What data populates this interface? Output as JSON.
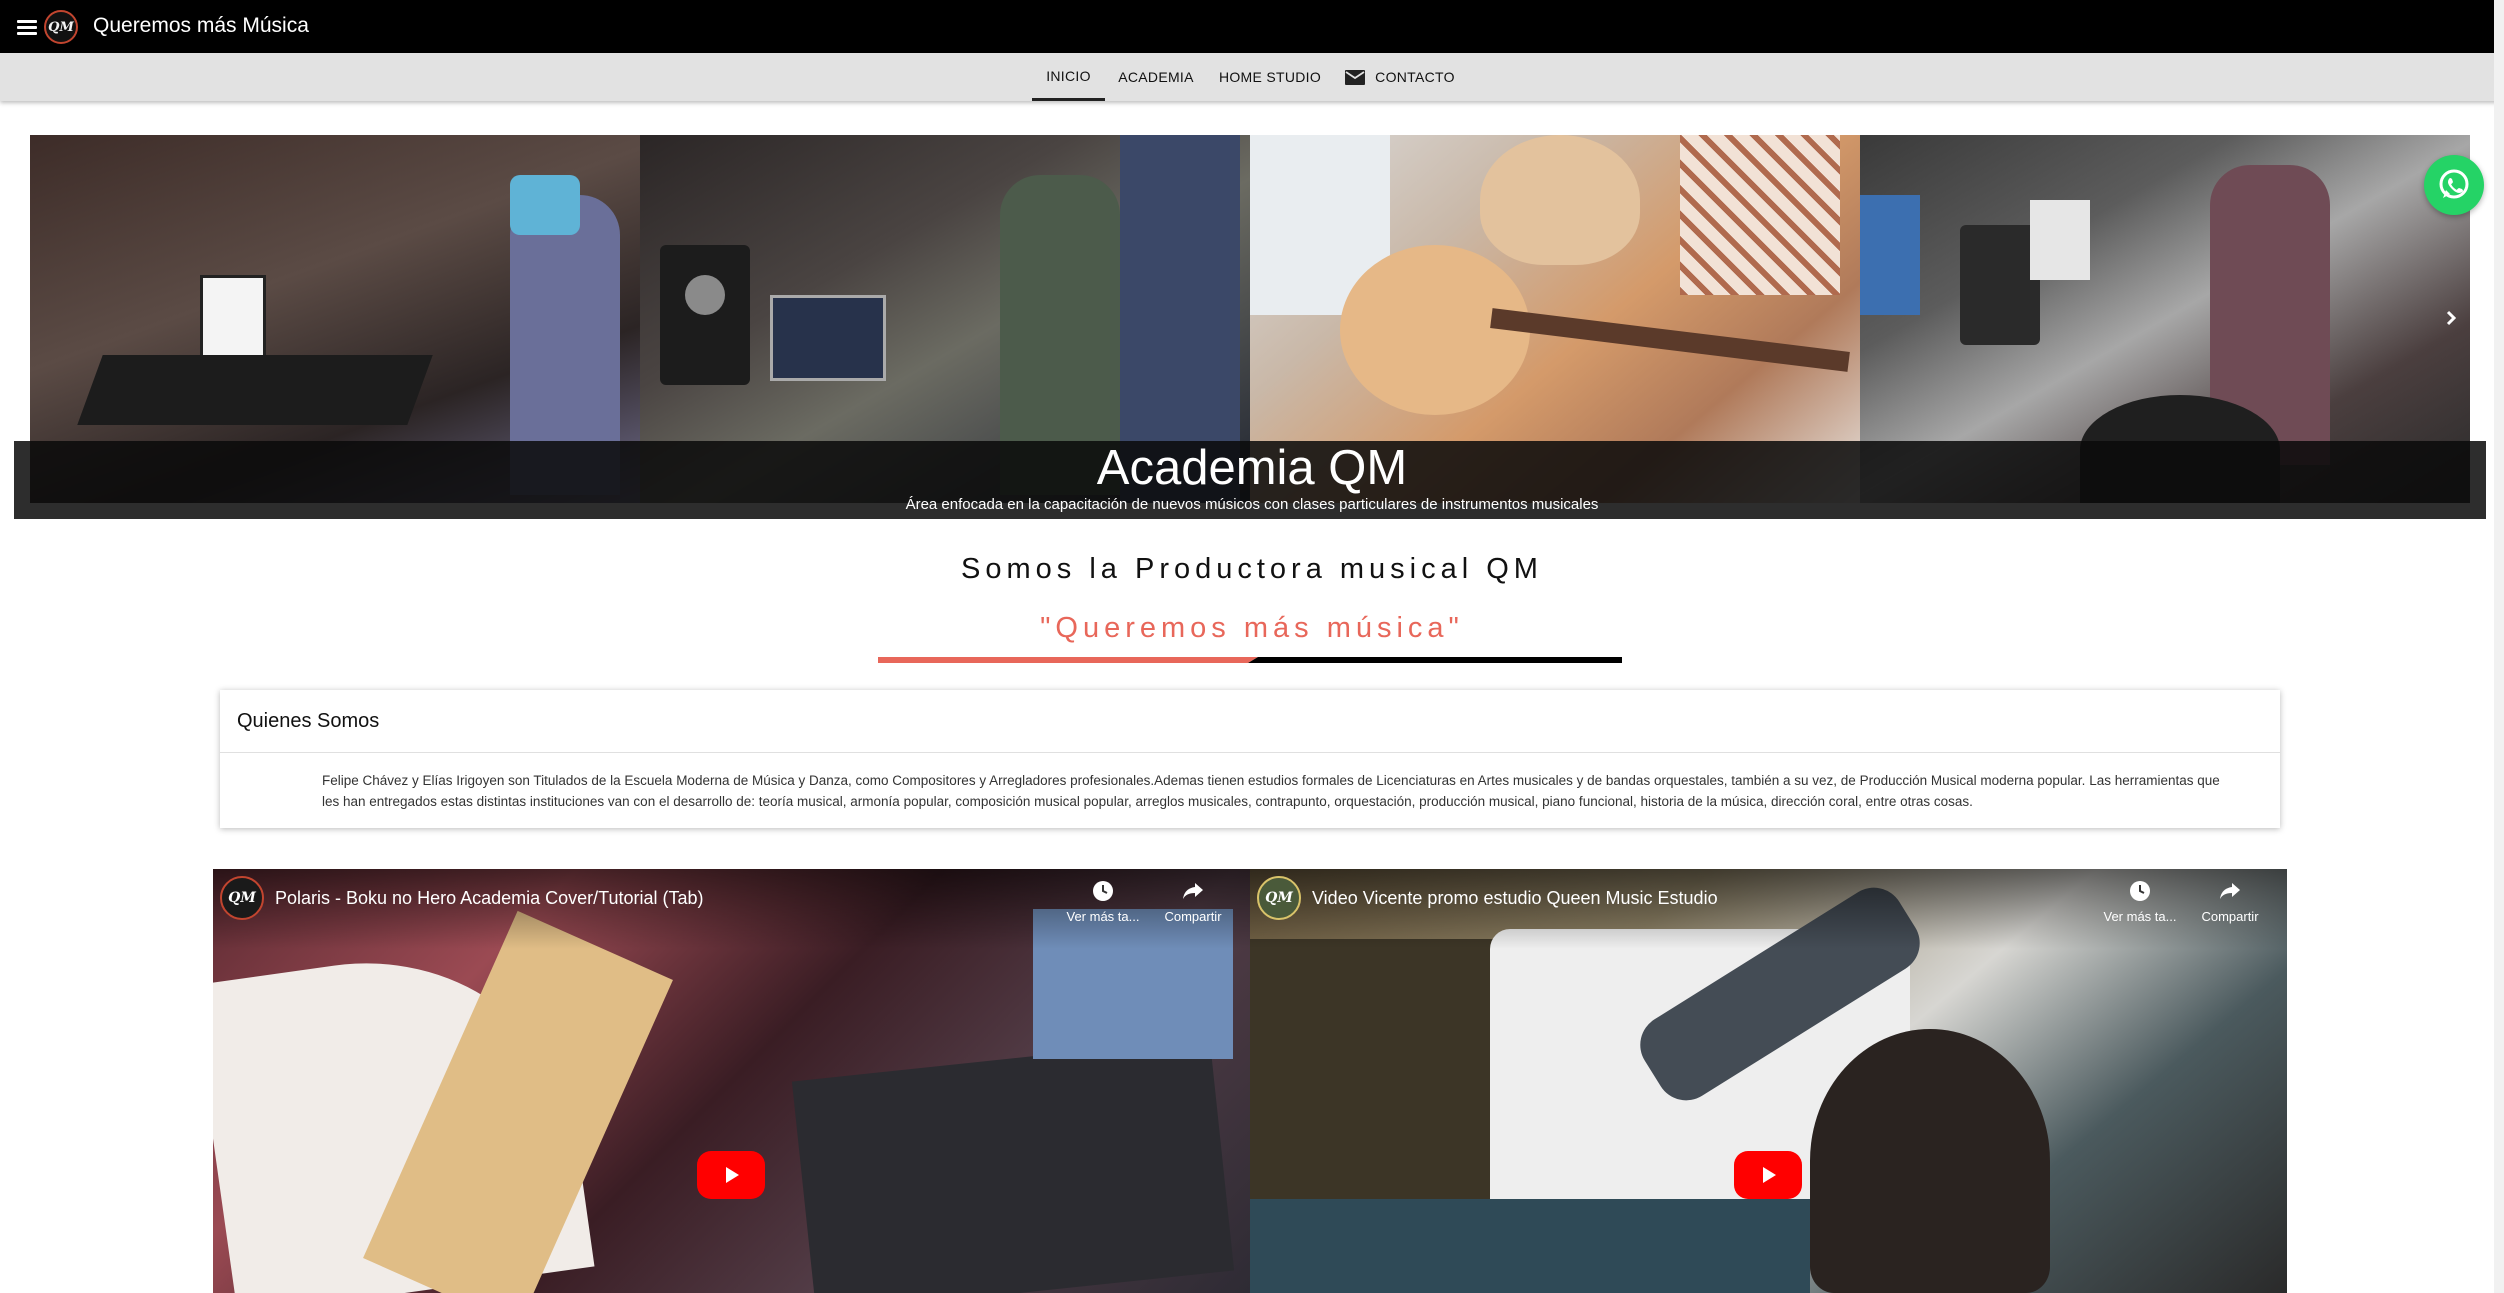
{
  "app": {
    "title": "Queremos más Música",
    "logo_text": "QM"
  },
  "nav": {
    "tabs": [
      {
        "label": "INICIO"
      },
      {
        "label": "ACADEMIA"
      },
      {
        "label": "HOME STUDIO"
      },
      {
        "label": "CONTACTO"
      }
    ],
    "active_tab": "INICIO"
  },
  "carousel": {
    "caption_title": "Academia QM",
    "caption_subtitle": "Área enfocada en la capacitación de nuevos músicos con clases particulares de instrumentos musicales"
  },
  "hero": {
    "headline": "Somos la Productora musical QM",
    "slogan": "\"Queremos más música\""
  },
  "about": {
    "title": "Quienes Somos",
    "text": "Felipe Chávez y Elías Irigoyen son Titulados de la Escuela Moderna de Música y Danza, como Compositores y Arregladores profesionales.Ademas tienen estudios formales de Licenciaturas en Artes musicales y de bandas orquestales, también a su vez, de Producción Musical moderna popular. Las herramientas que les han entregados estas distintas instituciones van con el desarrollo de: teoría musical, armonía popular, composición musical popular, arreglos musicales, contrapunto, orquestación, producción musical, piano funcional, historia de la música, dirección coral, entre otras cosas."
  },
  "videos": [
    {
      "title": "Polaris - Boku no Hero Academia Cover/Tutorial (Tab)",
      "watch_later": "Ver más ta...",
      "share": "Compartir",
      "channel_text": "QM"
    },
    {
      "title": "Video Vicente promo estudio Queen Music Estudio",
      "watch_later": "Ver más ta...",
      "share": "Compartir",
      "channel_text": "QM"
    }
  ],
  "colors": {
    "topbar": "#000000",
    "tabs_bg": "#e2e2e2",
    "accent_red": "#e8675a",
    "whatsapp": "#25d366",
    "youtube_red": "#ff0000"
  },
  "icons": [
    "menu-icon",
    "mail-icon",
    "chevron-right-icon",
    "whatsapp-icon",
    "clock-icon",
    "share-icon",
    "play-icon"
  ]
}
